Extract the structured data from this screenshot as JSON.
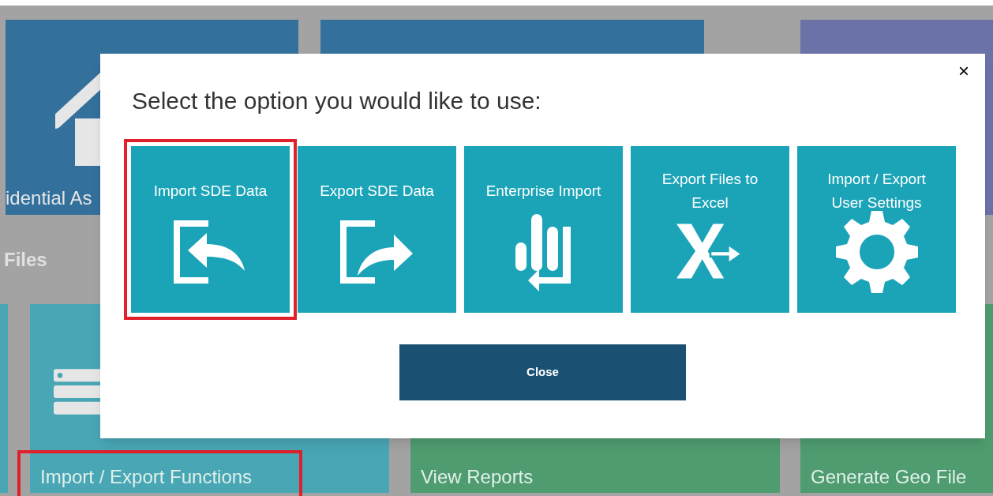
{
  "background": {
    "tiles": [
      {
        "kind": "house",
        "label": "idential As",
        "color": "#33709c"
      },
      {
        "kind": "plain",
        "color": "#33709c"
      },
      {
        "kind": "plain",
        "color": "#6a72a8"
      }
    ],
    "section_heading": "Files",
    "tiles_row_2": [
      {
        "kind": "edge",
        "color": "#48a6b5"
      },
      {
        "kind": "server",
        "label": "Import / Export Functions",
        "color": "#48a6b5",
        "highlighted": true
      },
      {
        "kind": "plain",
        "label": "View Reports",
        "color": "#4f9c70",
        "highlighted": false
      },
      {
        "kind": "plain",
        "label": "Generate Geo File",
        "color": "#4f9c70",
        "highlighted": false
      }
    ]
  },
  "dialog": {
    "title": "Select the option you would like to use:",
    "close_icon": "×",
    "options": [
      {
        "kind": "import",
        "label": "Import SDE Data",
        "selected": true
      },
      {
        "kind": "export",
        "label": "Export SDE Data",
        "selected": false
      },
      {
        "kind": "enterprise",
        "label": "Enterprise Import",
        "selected": false
      },
      {
        "kind": "excel",
        "label": "Export Files to Excel",
        "selected": false
      },
      {
        "kind": "settings",
        "label": "Import / Export User Settings",
        "selected": false
      }
    ],
    "button": "Close"
  }
}
